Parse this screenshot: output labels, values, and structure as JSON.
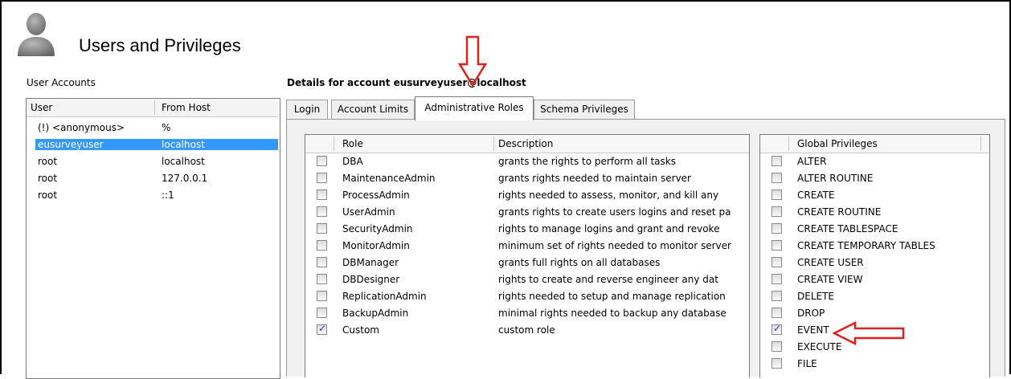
{
  "header": {
    "title": "Users and Privileges",
    "icon": "user-silhouette-icon"
  },
  "accounts": {
    "label": "User Accounts",
    "columns": [
      "User",
      "From Host"
    ],
    "rows": [
      {
        "user": "(!) <anonymous>",
        "host": "%"
      },
      {
        "user": "eusurveyuser",
        "host": "localhost",
        "selected": true
      },
      {
        "user": "root",
        "host": "localhost"
      },
      {
        "user": "root",
        "host": "127.0.0.1"
      },
      {
        "user": "root",
        "host": "::1"
      }
    ]
  },
  "details": {
    "title": "Details for account eusurveyuser@localhost"
  },
  "tabs": [
    {
      "label": "Login"
    },
    {
      "label": "Account Limits"
    },
    {
      "label": "Administrative Roles",
      "active": true
    },
    {
      "label": "Schema Privileges"
    }
  ],
  "roles": {
    "columns": [
      "Role",
      "Description"
    ],
    "rows": [
      {
        "role": "DBA",
        "description": "grants the rights to perform all tasks",
        "checked": false
      },
      {
        "role": "MaintenanceAdmin",
        "description": "grants rights needed to maintain server",
        "checked": false
      },
      {
        "role": "ProcessAdmin",
        "description": "rights needed to assess, monitor, and kill any",
        "checked": false
      },
      {
        "role": "UserAdmin",
        "description": "grants rights to create users logins and reset pa",
        "checked": false
      },
      {
        "role": "SecurityAdmin",
        "description": "rights to manage logins and grant and revoke",
        "checked": false
      },
      {
        "role": "MonitorAdmin",
        "description": "minimum set of rights needed to monitor server",
        "checked": false
      },
      {
        "role": "DBManager",
        "description": "grants full rights on all databases",
        "checked": false
      },
      {
        "role": "DBDesigner",
        "description": "rights to create and reverse engineer any dat",
        "checked": false
      },
      {
        "role": "ReplicationAdmin",
        "description": "rights needed to setup and manage replication",
        "checked": false
      },
      {
        "role": "BackupAdmin",
        "description": "minimal rights needed to backup any database",
        "checked": false
      },
      {
        "role": "Custom",
        "description": "custom role",
        "checked": true
      }
    ]
  },
  "global_privileges": {
    "column": "Global Privileges",
    "rows": [
      {
        "name": "ALTER",
        "checked": false
      },
      {
        "name": "ALTER ROUTINE",
        "checked": false
      },
      {
        "name": "CREATE",
        "checked": false
      },
      {
        "name": "CREATE ROUTINE",
        "checked": false
      },
      {
        "name": "CREATE TABLESPACE",
        "checked": false
      },
      {
        "name": "CREATE TEMPORARY TABLES",
        "checked": false
      },
      {
        "name": "CREATE USER",
        "checked": false
      },
      {
        "name": "CREATE VIEW",
        "checked": false
      },
      {
        "name": "DELETE",
        "checked": false
      },
      {
        "name": "DROP",
        "checked": false
      },
      {
        "name": "EVENT",
        "checked": true
      },
      {
        "name": "EXECUTE",
        "checked": false
      },
      {
        "name": "FILE",
        "checked": false
      }
    ]
  },
  "annotations": {
    "arrow_color": "#e0201a"
  }
}
